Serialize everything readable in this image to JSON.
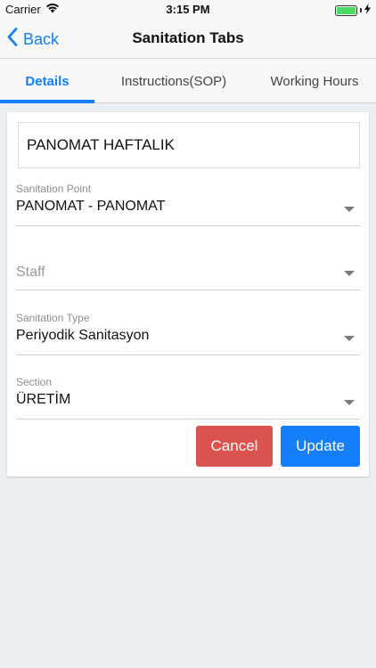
{
  "status_bar": {
    "carrier": "Carrier",
    "time": "3:15 PM",
    "wifi_icon": "wifi-icon",
    "battery_level": 1.0,
    "charging_icon": "bolt-icon"
  },
  "nav": {
    "back_label": "Back",
    "title": "Sanitation Tabs"
  },
  "tabs": [
    {
      "label": "Details",
      "active": true
    },
    {
      "label": "Instructions(SOP)",
      "active": false
    },
    {
      "label": "Working Hours",
      "active": false
    }
  ],
  "form": {
    "name_value": "PANOMAT HAFTALIK",
    "sanitation_point": {
      "label": "Sanitation Point",
      "value": "PANOMAT - PANOMAT"
    },
    "staff": {
      "placeholder": "Staff",
      "value": ""
    },
    "sanitation_type": {
      "label": "Sanitation Type",
      "value": "Periyodik Sanitasyon"
    },
    "section": {
      "label": "Section",
      "value": "ÜRETİM"
    }
  },
  "buttons": {
    "cancel_label": "Cancel",
    "update_label": "Update"
  },
  "colors": {
    "accent": "#147efb",
    "cancel": "#da534f",
    "background": "#eceff1"
  }
}
